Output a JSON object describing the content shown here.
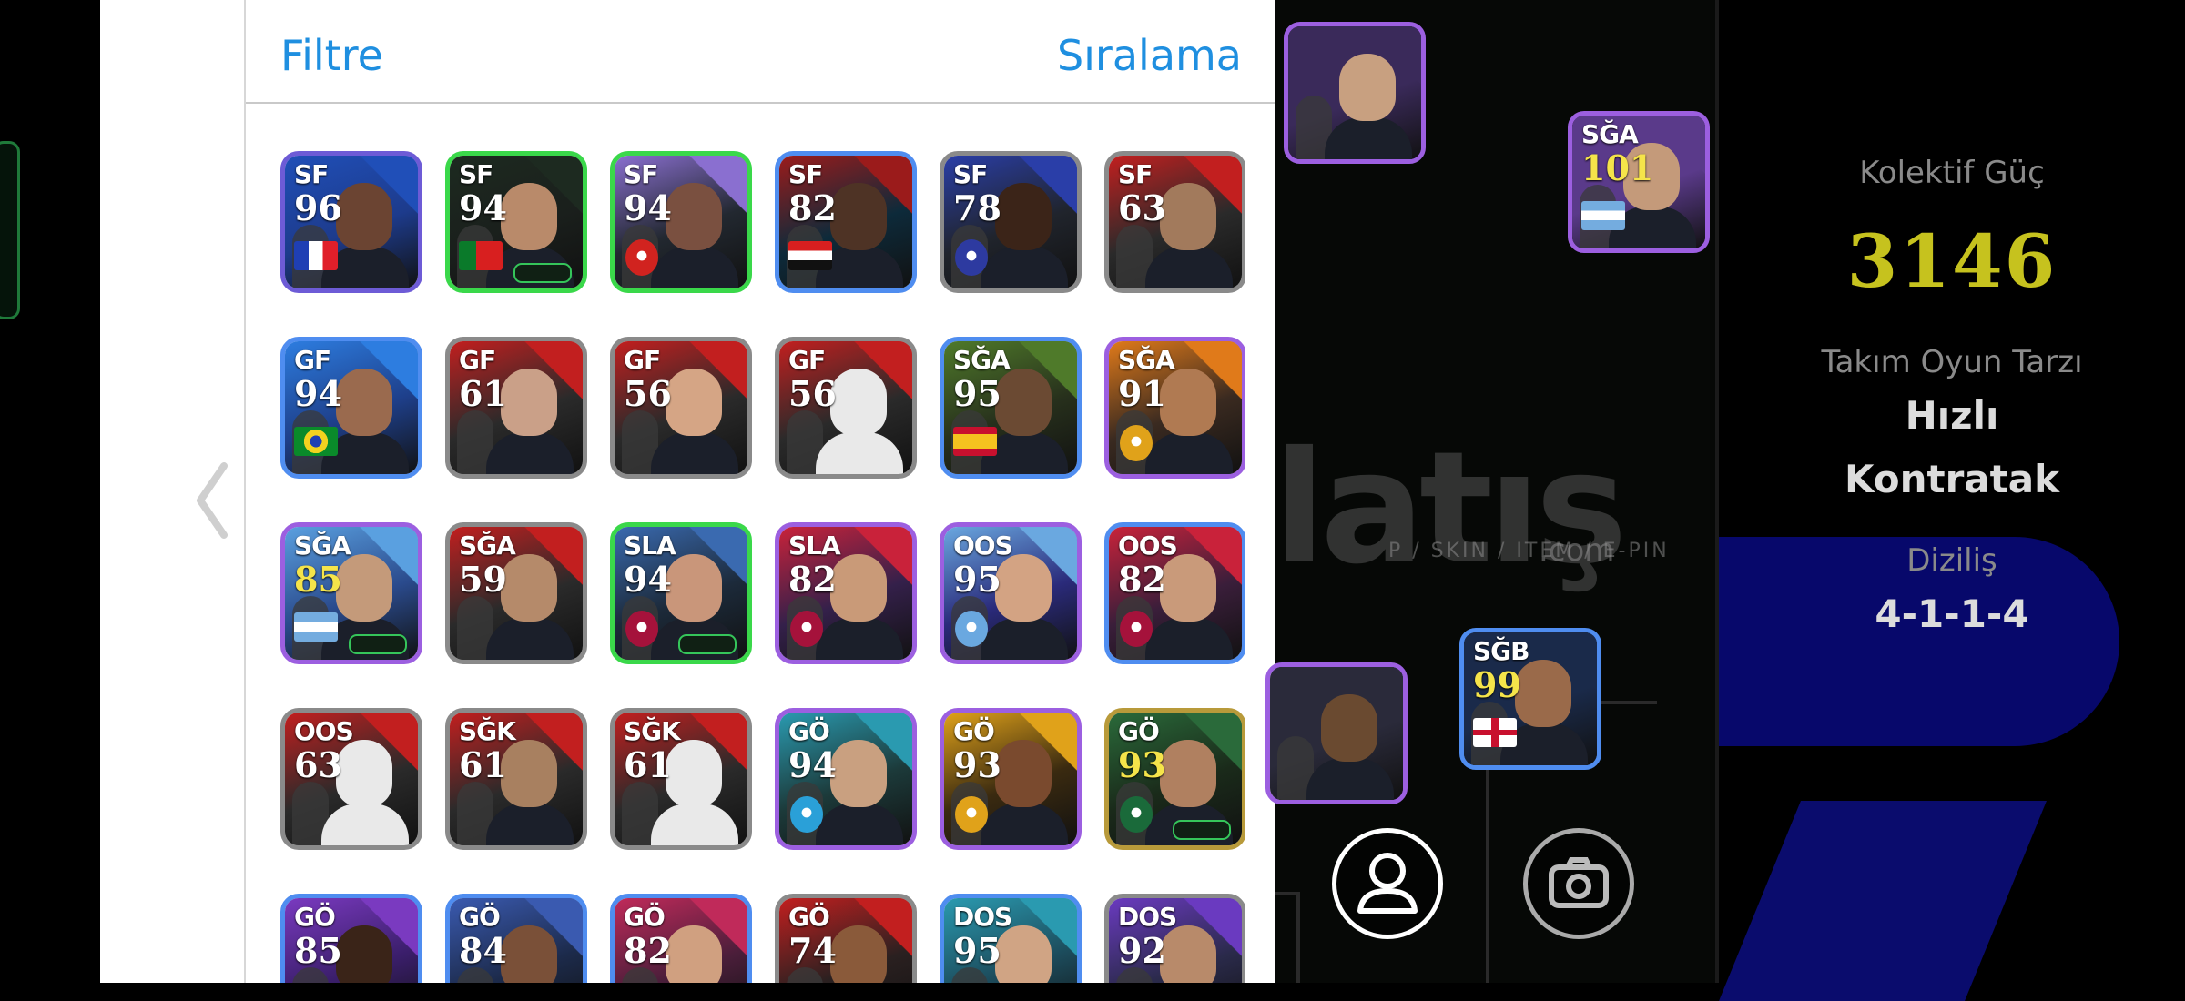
{
  "header": {
    "filter_label": "Filtre",
    "sort_label": "Sıralama"
  },
  "cards": [
    {
      "pos": "SF",
      "rating": "96",
      "flag": "fr",
      "frame": "#6d5bd6",
      "bg": "#1d3b8c",
      "skin": "#6b4432",
      "accent": "#204fb8",
      "type": "flag",
      "gold": false
    },
    {
      "pos": "SF",
      "rating": "94",
      "flag": "pt",
      "frame": "#3ad84a",
      "bg": "#1a1f1c",
      "skin": "#b98a6a",
      "accent": "#1d2a20",
      "type": "flag",
      "gold": false,
      "boost": true
    },
    {
      "pos": "SF",
      "rating": "94",
      "flag": "ars",
      "frame": "#3ad84a",
      "bg": "#222830",
      "skin": "#7a5040",
      "accent": "#8a6fd0",
      "type": "badge",
      "badge_color": "#d1231f",
      "gold": false
    },
    {
      "pos": "SF",
      "rating": "82",
      "flag": "eg",
      "frame": "#4f8df0",
      "bg": "#0d2a3a",
      "skin": "#4e3325",
      "accent": "#9b1b1b",
      "type": "flag",
      "gold": false
    },
    {
      "pos": "SF",
      "rating": "78",
      "flag": "club",
      "frame": "#8a8a8a",
      "bg": "#20242c",
      "skin": "#3b2418",
      "accent": "#2a3ea8",
      "type": "badge",
      "badge_color": "#2d3aa0",
      "gold": false
    },
    {
      "pos": "SF",
      "rating": "63",
      "flag": "none",
      "frame": "#8a8a8a",
      "bg": "#2a2a2a",
      "skin": "#a27a5c",
      "accent": "#c21f1f",
      "type": "none",
      "gold": false
    },
    {
      "pos": "GF",
      "rating": "94",
      "flag": "br",
      "frame": "#4f8df0",
      "bg": "#1e3f8a",
      "skin": "#9a6a4e",
      "accent": "#2d7de0",
      "type": "flag",
      "gold": false
    },
    {
      "pos": "GF",
      "rating": "61",
      "flag": "none",
      "frame": "#8a8a8a",
      "bg": "#2a2a2a",
      "skin": "#caa088",
      "accent": "#c21f1f",
      "type": "none",
      "gold": false
    },
    {
      "pos": "GF",
      "rating": "56",
      "flag": "none",
      "frame": "#8a8a8a",
      "bg": "#2a2a2a",
      "skin": "#d5a585",
      "accent": "#c21f1f",
      "type": "none",
      "gold": false
    },
    {
      "pos": "GF",
      "rating": "56",
      "flag": "none",
      "frame": "#8a8a8a",
      "bg": "#2a2a2a",
      "skin": "#e9e9e9",
      "accent": "#c21f1f",
      "type": "none",
      "gold": false
    },
    {
      "pos": "SĞA",
      "rating": "95",
      "flag": "es",
      "frame": "#4f8df0",
      "bg": "#27301c",
      "skin": "#6b4a33",
      "accent": "#4f7a2a",
      "type": "flag",
      "gold": false
    },
    {
      "pos": "SĞA",
      "rating": "91",
      "flag": "gs",
      "frame": "#9c5fe0",
      "bg": "#3a2a20",
      "skin": "#b07a52",
      "accent": "#e07a1a",
      "type": "badge",
      "badge_color": "#e0a21a",
      "gold": false
    },
    {
      "pos": "SĞA",
      "rating": "85",
      "flag": "ar",
      "frame": "#9c5fe0",
      "bg": "#2a4a8c",
      "skin": "#c49a7a",
      "accent": "#5aa0e0",
      "type": "flag",
      "gold": true,
      "boost": true
    },
    {
      "pos": "SĞA",
      "rating": "59",
      "flag": "none",
      "frame": "#8a8a8a",
      "bg": "#2a2a2a",
      "skin": "#b58a6a",
      "accent": "#c21f1f",
      "type": "none",
      "gold": false
    },
    {
      "pos": "SLA",
      "rating": "94",
      "flag": "fcb",
      "frame": "#3ad84a",
      "bg": "#1c2a3a",
      "skin": "#c9967a",
      "accent": "#3a6ab0",
      "type": "badge",
      "badge_color": "#a5123b",
      "gold": false,
      "boost": true
    },
    {
      "pos": "SLA",
      "rating": "82",
      "flag": "fcb",
      "frame": "#9c5fe0",
      "bg": "#34204a",
      "skin": "#c99a78",
      "accent": "#c9223a",
      "type": "badge",
      "badge_color": "#a5123b",
      "gold": false
    },
    {
      "pos": "OOS",
      "rating": "95",
      "flag": "mci",
      "frame": "#9c5fe0",
      "bg": "#2a2a7a",
      "skin": "#d3a383",
      "accent": "#6aa8e0",
      "type": "badge",
      "badge_color": "#6aa8e0",
      "gold": false
    },
    {
      "pos": "OOS",
      "rating": "82",
      "flag": "fcb",
      "frame": "#4f8df0",
      "bg": "#3a1e3a",
      "skin": "#c99a7a",
      "accent": "#c9223a",
      "type": "badge",
      "badge_color": "#a5123b",
      "gold": false
    },
    {
      "pos": "OOS",
      "rating": "63",
      "flag": "none",
      "frame": "#8a8a8a",
      "bg": "#2a2a2a",
      "skin": "#e9e9e9",
      "accent": "#c21f1f",
      "type": "none",
      "gold": false
    },
    {
      "pos": "SĞK",
      "rating": "61",
      "flag": "none",
      "frame": "#8a8a8a",
      "bg": "#2a2a2a",
      "skin": "#a88060",
      "accent": "#c21f1f",
      "type": "none",
      "gold": false
    },
    {
      "pos": "SĞK",
      "rating": "61",
      "flag": "none",
      "frame": "#8a8a8a",
      "bg": "#2a2a2a",
      "skin": "#e9e9e9",
      "accent": "#c21f1f",
      "type": "none",
      "gold": false
    },
    {
      "pos": "GÖ",
      "rating": "94",
      "flag": "om",
      "frame": "#9c5fe0",
      "bg": "#1c3a3a",
      "skin": "#c9a080",
      "accent": "#2a9ab0",
      "type": "badge",
      "badge_color": "#2aa0d8",
      "gold": false
    },
    {
      "pos": "GÖ",
      "rating": "93",
      "flag": "gs",
      "frame": "#9c5fe0",
      "bg": "#3a2a10",
      "skin": "#7a4a2e",
      "accent": "#e0a21a",
      "type": "badge",
      "badge_color": "#e0a21a",
      "gold": false
    },
    {
      "pos": "GÖ",
      "rating": "93",
      "flag": "flu",
      "frame": "#b89a3a",
      "bg": "#1a2a1a",
      "skin": "#b08060",
      "accent": "#2a6a3a",
      "type": "badge",
      "badge_color": "#1a6a3a",
      "gold": true,
      "boost": true
    },
    {
      "pos": "GÖ",
      "rating": "85",
      "flag": "none",
      "frame": "#4f8df0",
      "bg": "#3a1e6a",
      "skin": "#3a2418",
      "accent": "#7a3ac0",
      "type": "none",
      "gold": false
    },
    {
      "pos": "GÖ",
      "rating": "84",
      "flag": "none",
      "frame": "#4f8df0",
      "bg": "#1c2a4a",
      "skin": "#7a5038",
      "accent": "#3a5ab0",
      "type": "none",
      "gold": false
    },
    {
      "pos": "GÖ",
      "rating": "82",
      "flag": "none",
      "frame": "#4f8df0",
      "bg": "#4a1e3a",
      "skin": "#d0a080",
      "accent": "#c02a5a",
      "type": "none",
      "gold": false
    },
    {
      "pos": "GÖ",
      "rating": "74",
      "flag": "none",
      "frame": "#8a8a8a",
      "bg": "#2a2020",
      "skin": "#8a5a3a",
      "accent": "#c21f1f",
      "type": "none",
      "gold": false
    },
    {
      "pos": "DOS",
      "rating": "95",
      "flag": "none",
      "frame": "#4f8df0",
      "bg": "#1c4a5a",
      "skin": "#d0a484",
      "accent": "#2a9ab0",
      "type": "none",
      "gold": false
    },
    {
      "pos": "DOS",
      "rating": "92",
      "flag": "none",
      "frame": "#8a8a8a",
      "bg": "#2a2a4a",
      "skin": "#b88a6a",
      "accent": "#6a3ac0",
      "type": "none",
      "gold": false
    }
  ],
  "pitch_cards": [
    {
      "pos": "",
      "rating": "",
      "frame": "#9c5fe0",
      "bg": "#3a2a5a",
      "skin": "#c8a080"
    },
    {
      "pos": "SĞA",
      "rating": "101",
      "frame": "#9c5fe0",
      "bg": "#5a3a8a",
      "skin": "#c49a7a",
      "flag": "ar",
      "gold": true
    },
    {
      "pos": "SĞB",
      "rating": "99",
      "frame": "#4f8df0",
      "bg": "#1a2a4a",
      "skin": "#9a6a4a",
      "flag": "en",
      "gold": true
    },
    {
      "pos": "",
      "rating": "",
      "frame": "#9c5fe0",
      "bg": "#2a2a3a",
      "skin": "#6a4a30"
    }
  ],
  "watermark": {
    "text": "latış",
    "sub": "P / SKIN / ITEM / E-PIN",
    "com": ".com"
  },
  "info": {
    "power_label": "Kolektif Güç",
    "power_value": "3146",
    "style_label": "Takım Oyun Tarzı",
    "style_value_1": "Hızlı",
    "style_value_2": "Kontratak",
    "formation_label": "Diziliş",
    "formation_value": "4-1-1-4"
  }
}
